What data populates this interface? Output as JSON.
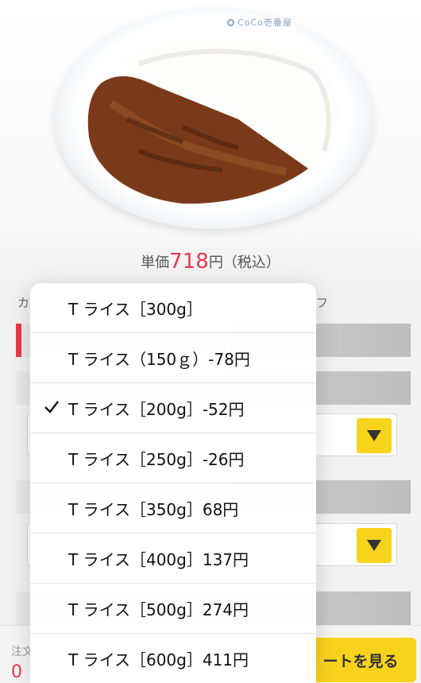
{
  "plate": {
    "brand_logo": "CoCo壱番屋"
  },
  "price": {
    "prefix": "単価",
    "amount": "718",
    "suffix": "円（税込）"
  },
  "background": {
    "section_label_left": "カ",
    "section_label_right": "フ"
  },
  "bottom_bar": {
    "order_label": "注文",
    "order_count": "0",
    "cart_button_label": "ートを見る"
  },
  "rice_options": [
    {
      "label": "T ライス［300g］",
      "selected": false
    },
    {
      "label": "T ライス（150ｇ）-78円",
      "selected": false
    },
    {
      "label": "T ライス［200g］-52円",
      "selected": true
    },
    {
      "label": "T ライス［250g］-26円",
      "selected": false
    },
    {
      "label": "T ライス［350g］68円",
      "selected": false
    },
    {
      "label": "T ライス［400g］137円",
      "selected": false
    },
    {
      "label": "T ライス［500g］274円",
      "selected": false
    },
    {
      "label": "T ライス［600g］411円",
      "selected": false
    }
  ],
  "colors": {
    "accent_red": "#e8384f",
    "accent_yellow": "#f8d31c"
  },
  "icons": {
    "selected_marker": "checkmark-icon",
    "dropdown": "triangle-down-icon"
  }
}
